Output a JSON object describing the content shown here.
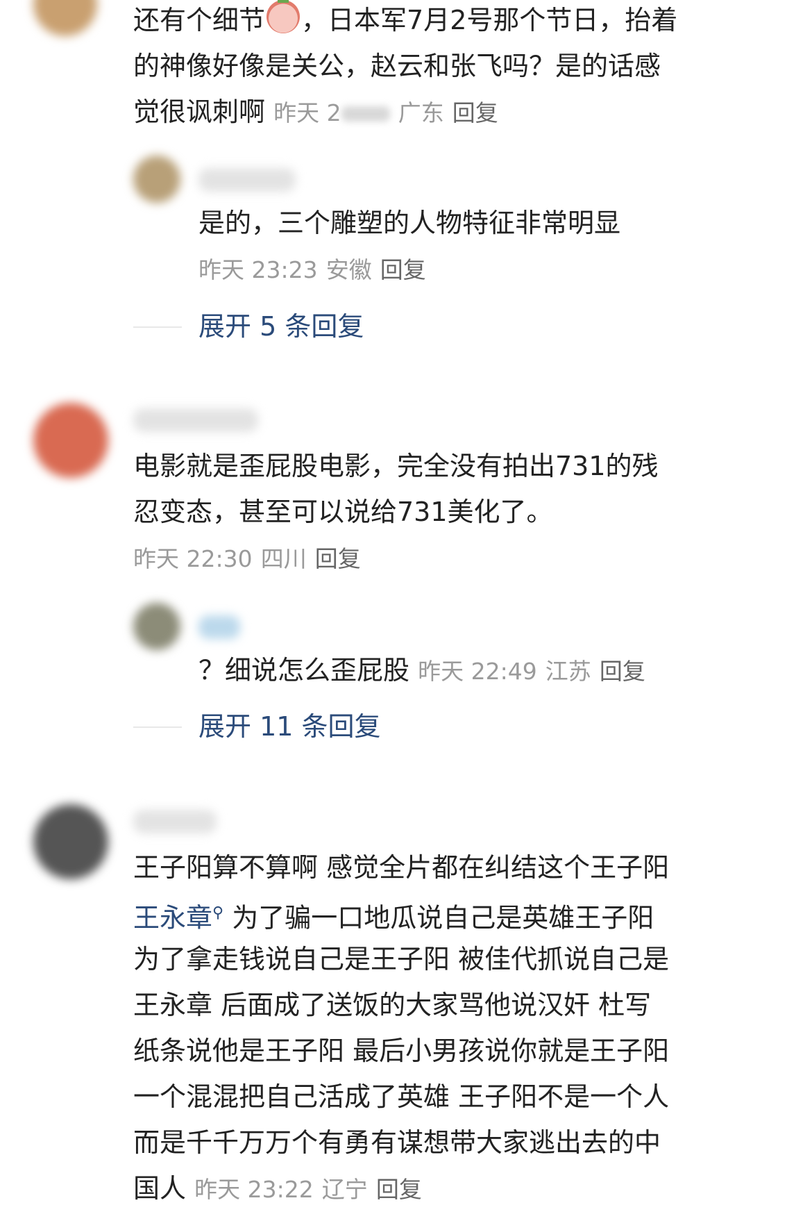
{
  "comments": [
    {
      "id": "c1",
      "text_lines": [
        "还有个细节",
        "，日本军7月2号那个节日，抬着",
        "的神像好像是关公，赵云和张飞吗？是的话感",
        "觉很讽刺啊"
      ],
      "time": "昨天 2",
      "location": "广东",
      "reply_label": "回复",
      "replies": [
        {
          "text": "是的，三个雕塑的人物特征非常明显",
          "time": "昨天 23:23",
          "location": "安徽",
          "reply_label": "回复"
        }
      ],
      "expand_label": "展开 5 条回复"
    },
    {
      "id": "c2",
      "text_lines": [
        "电影就是歪屁股电影，完全没有拍出731的残",
        "忍变态，甚至可以说给731美化了。"
      ],
      "time": "昨天 22:30",
      "location": "四川",
      "reply_label": "回复",
      "replies": [
        {
          "text": "？细说怎么歪屁股",
          "time": "昨天 22:49",
          "location": "江苏",
          "reply_label": "回复"
        }
      ],
      "expand_label": "展开 11 条回复"
    },
    {
      "id": "c3",
      "text_lines": [
        "王子阳算不算啊 感觉全片都在纠结这个王子阳",
        "为了骗一口地瓜说自己是英雄王子阳",
        "为了拿走钱说自己是王子阳 被佳代抓说自己是",
        "王永章  后面成了送饭的大家骂他说汉奸 杜写",
        "纸条说他是王子阳  最后小男孩说你就是王子阳",
        "一个混混把自己活成了英雄  王子阳不是一个人",
        "而是千千万万个有勇有谋想带大家逃出去的中",
        "国人"
      ],
      "link_text": "王永章",
      "time": "昨天 23:22",
      "location": "辽宁",
      "reply_label": "回复"
    }
  ],
  "icons": {
    "emoji": "smiling-radish-emoji-icon",
    "search_link": "search-lens-icon"
  },
  "colors": {
    "text": "#222222",
    "meta": "#9a9a9a",
    "link": "#2b4b7a",
    "background": "#ffffff"
  }
}
